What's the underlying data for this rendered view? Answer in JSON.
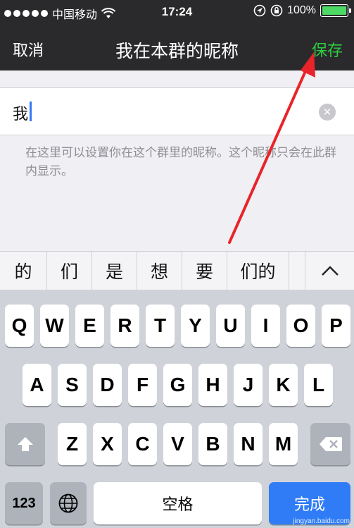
{
  "status": {
    "carrier": "中国移动",
    "time": "17:24",
    "battery": "100%",
    "battery_level": 1.0,
    "accent_green": "#4cd964"
  },
  "nav": {
    "cancel": "取消",
    "title": "我在本群的昵称",
    "save": "保存",
    "save_color": "#2ecc40"
  },
  "input": {
    "value": "我"
  },
  "hint": "在这里可以设置你在这个群里的昵称。这个昵称只会在此群内显示。",
  "candidates": [
    "的",
    "们",
    "是",
    "想",
    "要",
    "们的"
  ],
  "keyboard": {
    "row1": [
      "Q",
      "W",
      "E",
      "R",
      "T",
      "Y",
      "U",
      "I",
      "O",
      "P"
    ],
    "row2": [
      "A",
      "S",
      "D",
      "F",
      "G",
      "H",
      "J",
      "K",
      "L"
    ],
    "row3": [
      "Z",
      "X",
      "C",
      "V",
      "B",
      "N",
      "M"
    ],
    "num": "123",
    "space": "空格",
    "done": "完成",
    "icons": [
      "shift-icon",
      "backspace-icon",
      "globe-icon",
      "chevron-up-icon",
      "clear-icon"
    ]
  },
  "watermark": "jingyan.baidu.com"
}
